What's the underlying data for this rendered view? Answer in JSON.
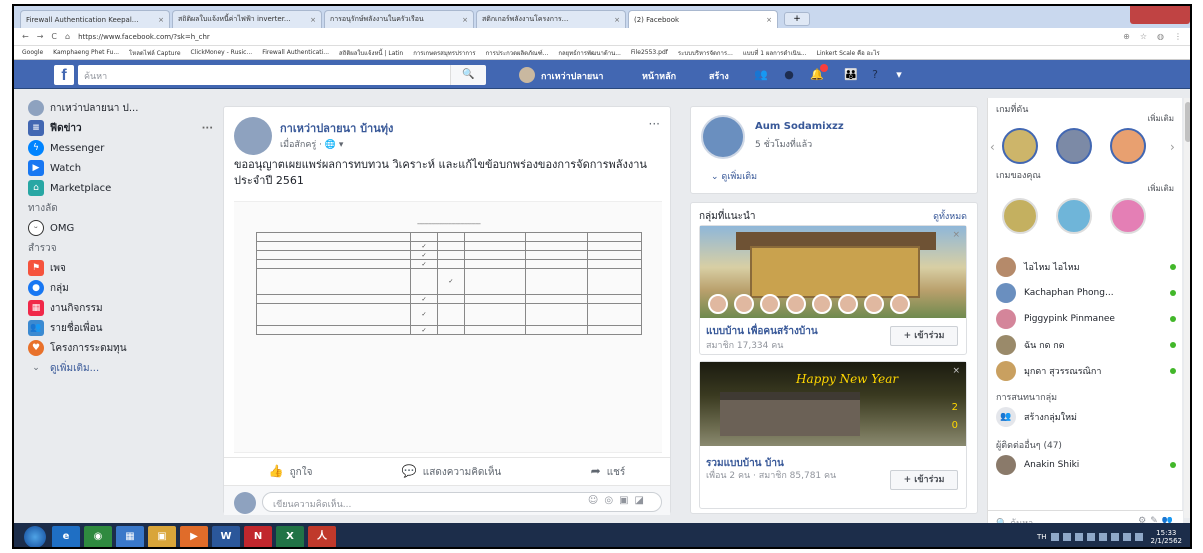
{
  "browser": {
    "tabs": [
      {
        "label": "Firewall Authentication Keepal..."
      },
      {
        "label": "สถิติผลใบแจ้งหนี้ค่าไฟฟ้า inverter..."
      },
      {
        "label": "การอนุรักษ์พลังงานในครัวเรือน"
      },
      {
        "label": "สติกเกอร์พลังงานโครงการ..."
      },
      {
        "label": "(2) Facebook"
      }
    ],
    "url": "https://www.facebook.com/?sk=h_chr",
    "bookmarks": [
      "Google",
      "Kamphaeng Phet Fu...",
      "โหลดไฟล์ Capture",
      "ClickMoney - Rusic...",
      "Firewall Authenticati...",
      "สถิติผลใบแจ้งหนี้ | Latin",
      "การเกษตรสมุทรปราการ",
      "การประกวดผลิตภัณฑ์...",
      "กลยุทธ์การพัฒนาด้าน...",
      "File2553.pdf",
      "ระบบบริหารจัดการ...",
      "แบบที่ 1 ผลการดำเนิน...",
      "Linkert Scale คือ อะไร"
    ]
  },
  "topbar": {
    "logo": "f",
    "search_placeholder": "ค้นหา",
    "profile_name": "กาเหว่าปลายนา",
    "home": "หน้าหลัก",
    "create": "สร้าง"
  },
  "left_nav": {
    "profile": "กาเหว่าปลายนา ป...",
    "items": [
      {
        "label": "ฟีดข่าว",
        "icon": "news-feed-icon",
        "color": "#4267b2"
      },
      {
        "label": "Messenger",
        "icon": "messenger-icon",
        "color": "#0084ff"
      },
      {
        "label": "Watch",
        "icon": "watch-icon",
        "color": "#1877f2"
      },
      {
        "label": "Marketplace",
        "icon": "marketplace-icon",
        "color": "#28a7a4"
      }
    ],
    "shortcuts_title": "ทางลัด",
    "shortcuts": [
      {
        "label": "OMG",
        "icon": "omg-icon"
      }
    ],
    "explore_title": "สำรวจ",
    "explore": [
      {
        "label": "เพจ",
        "icon": "pages-icon",
        "color": "#f5533d"
      },
      {
        "label": "กลุ่ม",
        "icon": "groups-icon",
        "color": "#1877f2"
      },
      {
        "label": "งานกิจกรรม",
        "icon": "events-icon",
        "color": "#f02849"
      },
      {
        "label": "รายชื่อเพื่อน",
        "icon": "friends-list-icon",
        "color": "#3b8ad1"
      },
      {
        "label": "โครงการระดมทุน",
        "icon": "fundraisers-icon",
        "color": "#e8712b"
      }
    ],
    "see_more": "ดูเพิ่มเติม..."
  },
  "post": {
    "author": "กาเหว่าปลายนา บ้านทุ่ง",
    "time": "เมื่อสักครู่ · 🌐 ▾",
    "text": "ขออนุญาตเผยแพร่ผลการทบทวน วิเคราะห์ และแก้ไขข้อบกพร่องของการจัดการพลังงานประจำปี 2561",
    "actions": {
      "like": "ถูกใจ",
      "comment": "แสดงความคิดเห็น",
      "share": "แชร์"
    },
    "comment_placeholder": "เขียนความคิดเห็น..."
  },
  "profile_card": {
    "name": "Aum Sodamixzz",
    "time": "5 ชั่วโมงที่แล้ว",
    "see_more": "ดูเพิ่มเติม"
  },
  "suggested_groups": {
    "title": "กลุ่มที่แนะนำ",
    "see_all": "ดูทั้งหมด",
    "groups": [
      {
        "name": "แบบบ้าน เพื่อคนสร้างบ้าน",
        "members": "สมาชิก 17,334 คน",
        "join": "+ เข้าร่วม"
      },
      {
        "name": "รวมแบบบ้าน บ้าน",
        "members": "เพื่อน 2 คน · สมาชิก 85,781 คน",
        "join": "+ เข้าร่วม",
        "banner": "Happy New Year"
      }
    ]
  },
  "chat": {
    "stories_title": "เกมที่ดัน",
    "stories_more": "เพิ่มเติม",
    "games_title": "เกมของคุณ",
    "games_more": "เพิ่มเติม",
    "contacts": [
      {
        "name": "ไอไหม ไอไหม",
        "color": "#b58a6a"
      },
      {
        "name": "Kachaphan Phong...",
        "color": "#6a8fbf"
      },
      {
        "name": "Piggypink Pinmanee",
        "color": "#d4859a"
      },
      {
        "name": "ฉัน กด กด",
        "color": "#9a8a6a"
      },
      {
        "name": "มุกดา สุวรรณรณิกา",
        "color": "#c9a060"
      }
    ],
    "group_conversations": "การสนทนากลุ่ม",
    "create_group": "สร้างกลุ่มใหม่",
    "more_contacts": "ผู้ติดต่ออื่นๆ (47)",
    "extra_contacts": [
      {
        "name": "Anakin Shiki",
        "color": "#8a7a6a"
      }
    ],
    "search_placeholder": "ค้นหา"
  },
  "taskbar": {
    "apps": [
      {
        "label": "e",
        "icon": "ie-icon",
        "color": "#1f6fc4"
      },
      {
        "label": "◉",
        "icon": "chrome-icon",
        "color": "#2f8a3f"
      },
      {
        "label": "▦",
        "icon": "media-icon",
        "color": "#3a78c9"
      },
      {
        "label": "▣",
        "icon": "explorer-icon",
        "color": "#d9a53a"
      },
      {
        "label": "▶",
        "icon": "player-icon",
        "color": "#e06c2a"
      },
      {
        "label": "W",
        "icon": "word-icon",
        "color": "#2b579a"
      },
      {
        "label": "N",
        "icon": "pdf-reader-icon",
        "color": "#c1272d"
      },
      {
        "label": "X",
        "icon": "excel-icon",
        "color": "#217346"
      },
      {
        "label": "人",
        "icon": "acrobat-icon",
        "color": "#c0392b"
      }
    ],
    "lang": "TH",
    "time": "15:33",
    "date": "2/1/2562"
  }
}
